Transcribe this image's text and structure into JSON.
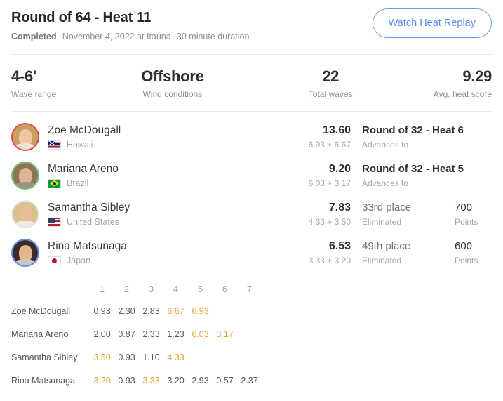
{
  "header": {
    "title": "Round of 64 - Heat 11",
    "status": "Completed",
    "meta_date": "November 4, 2022 at Itaúna",
    "meta_duration": "30 minute duration",
    "separator": "·",
    "replay_button": "Watch Heat Replay"
  },
  "stats": [
    {
      "value": "4-6'",
      "label": "Wave range"
    },
    {
      "value": "Offshore",
      "label": "Wind conditions"
    },
    {
      "value": "22",
      "label": "Total waves"
    },
    {
      "value": "9.29",
      "label": "Avg. heat score"
    }
  ],
  "athletes": [
    {
      "name": "Zoe McDougall",
      "country": "Hawaii",
      "flag": "hawaii-flag",
      "ring_color": "#e04a4a",
      "hair_color": "#c7a25f",
      "skin_color": "#efc6a4",
      "cloth_color": "#e9e3da",
      "total": "13.60",
      "waves_sum": "6.93 + 6.67",
      "result": "Round of 32 - Heat 6",
      "result_muted": false,
      "result_sub": "Advances to",
      "points": "",
      "points_label": ""
    },
    {
      "name": "Mariana Areno",
      "country": "Brazil",
      "flag": "brazil-flag",
      "ring_color": "#6fc06f",
      "hair_color": "#8c7454",
      "skin_color": "#ddb594",
      "cloth_color": "#9a937f",
      "total": "9.20",
      "waves_sum": "6.03 + 3.17",
      "result": "Round of 32 - Heat 5",
      "result_muted": false,
      "result_sub": "Advances to",
      "points": "",
      "points_label": ""
    },
    {
      "name": "Samantha Sibley",
      "country": "United States",
      "flag": "usa-flag",
      "ring_color": "#e6e8eb",
      "hair_color": "#d9c08c",
      "skin_color": "#e8bd97",
      "cloth_color": "#efe9e2",
      "total": "7.83",
      "waves_sum": "4.33 + 3.50",
      "result": "33rd place",
      "result_muted": true,
      "result_sub": "Eliminated",
      "points": "700",
      "points_label": "Points"
    },
    {
      "name": "Rina Matsunaga",
      "country": "Japan",
      "flag": "japan-flag",
      "ring_color": "#5b8def",
      "hair_color": "#3a2c24",
      "skin_color": "#e3b491",
      "cloth_color": "#cfc6bd",
      "total": "6.53",
      "waves_sum": "3.33 + 3.20",
      "result": "49th place",
      "result_muted": true,
      "result_sub": "Eliminated",
      "points": "600",
      "points_label": "Points"
    }
  ],
  "wave_table": {
    "columns": [
      "1",
      "2",
      "3",
      "4",
      "5",
      "6",
      "7"
    ],
    "rows": [
      {
        "name": "Zoe McDougall",
        "scores": [
          "0.93",
          "2.30",
          "2.83",
          "6.67",
          "6.93",
          "",
          ""
        ],
        "highlight": [
          false,
          false,
          false,
          true,
          true,
          false,
          false
        ]
      },
      {
        "name": "Mariana Areno",
        "scores": [
          "2.00",
          "0.87",
          "2.33",
          "1.23",
          "6.03",
          "3.17",
          ""
        ],
        "highlight": [
          false,
          false,
          false,
          false,
          true,
          true,
          false
        ]
      },
      {
        "name": "Samantha Sibley",
        "scores": [
          "3.50",
          "0.93",
          "1.10",
          "4.33",
          "",
          "",
          ""
        ],
        "highlight": [
          true,
          false,
          false,
          true,
          false,
          false,
          false
        ]
      },
      {
        "name": "Rina Matsunaga",
        "scores": [
          "3.20",
          "0.93",
          "3.33",
          "3.20",
          "2.93",
          "0.57",
          "2.37"
        ],
        "highlight": [
          true,
          false,
          true,
          false,
          false,
          false,
          false
        ]
      }
    ]
  },
  "colors": {
    "accent_blue": "#5b8def",
    "highlight_orange": "#eda22e",
    "text_primary": "#2b3034",
    "text_muted": "#a3a7ac"
  }
}
